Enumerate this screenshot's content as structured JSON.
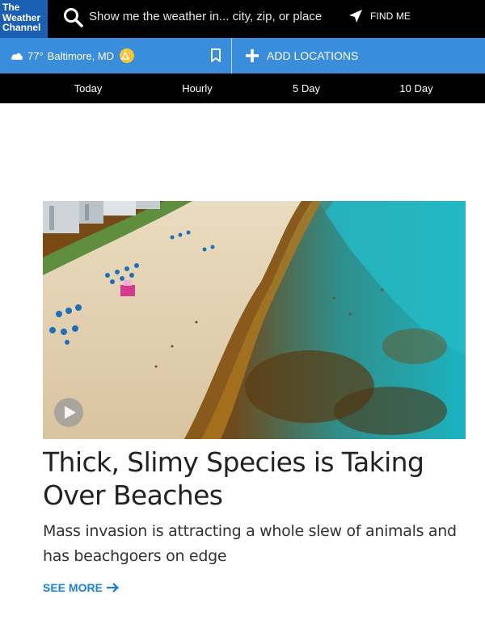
{
  "header": {
    "logo_lines": [
      "The",
      "Weather",
      "Channel"
    ],
    "search_placeholder": "Show me the weather in... city, zip, or place",
    "find_me_label": "FIND ME"
  },
  "location_bar": {
    "current_temp": "77°",
    "current_location": "Baltimore, MD",
    "add_locations_label": "ADD LOCATIONS"
  },
  "tabs": [
    {
      "label": "Today"
    },
    {
      "label": "Hourly"
    },
    {
      "label": "5 Day"
    },
    {
      "label": "10 Day"
    }
  ],
  "article": {
    "headline": "Thick, Slimy Species is Taking Over Beaches",
    "summary": "Mass invasion is attracting a whole slew of animals and has beachgoers on edge",
    "see_more_label": "SEE MORE"
  },
  "colors": {
    "brand_blue": "#1a5fb4",
    "location_bar_blue": "#3a8ddb",
    "link_blue": "#1b80d1",
    "alert_yellow": "#f3c73c"
  },
  "icons": [
    "search-icon",
    "navigation-arrow-icon",
    "cloud-icon",
    "alert-icon",
    "bookmark-icon",
    "plus-icon",
    "play-icon",
    "arrow-right-icon"
  ]
}
